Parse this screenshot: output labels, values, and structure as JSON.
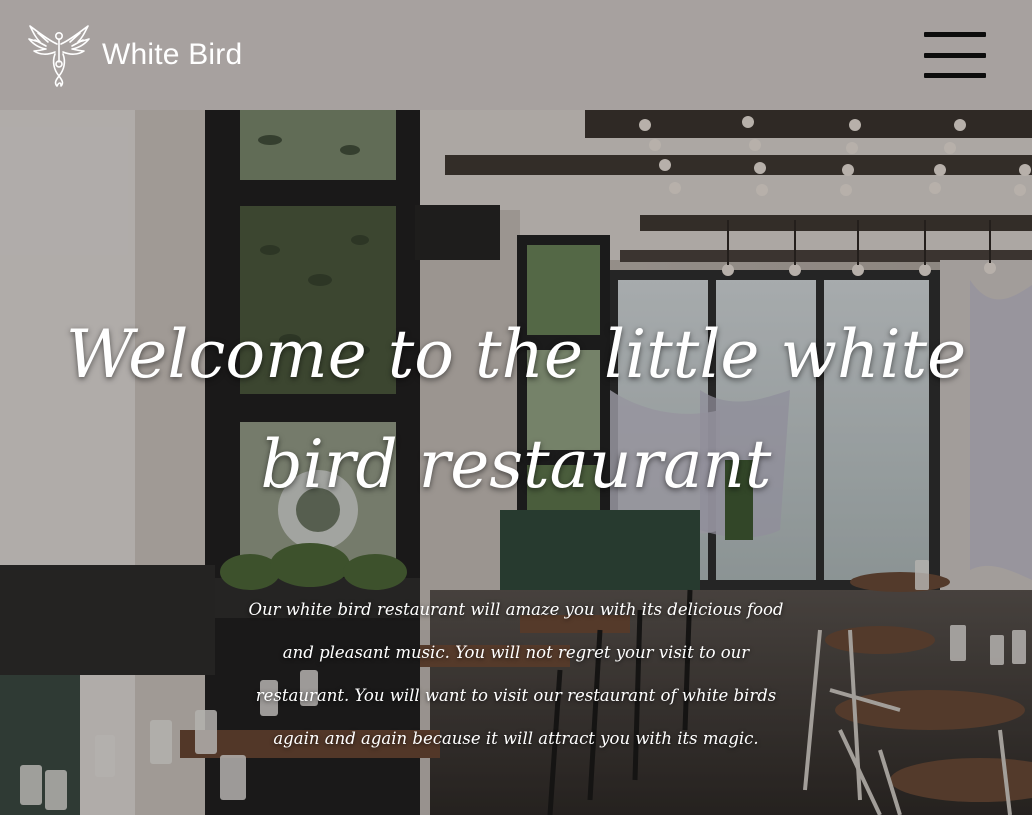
{
  "header": {
    "brand_name": "White Bird",
    "logo_icon": "phoenix-bird-icon",
    "menu_icon": "hamburger-menu-icon"
  },
  "hero": {
    "background": "restaurant-interior-photo",
    "title": "Welcome to the little white bird restaurant",
    "description": "Our white bird restaurant will amaze you with its delicious food and pleasant music. You will not regret your visit to our restaurant. You will want to visit our restaurant of white birds again and again because it will attract you with its magic."
  },
  "colors": {
    "header_bg": "#a7a19f",
    "brand_text": "#ffffff",
    "menu_icon": "#0c0c0c",
    "hero_text": "#ffffff"
  }
}
